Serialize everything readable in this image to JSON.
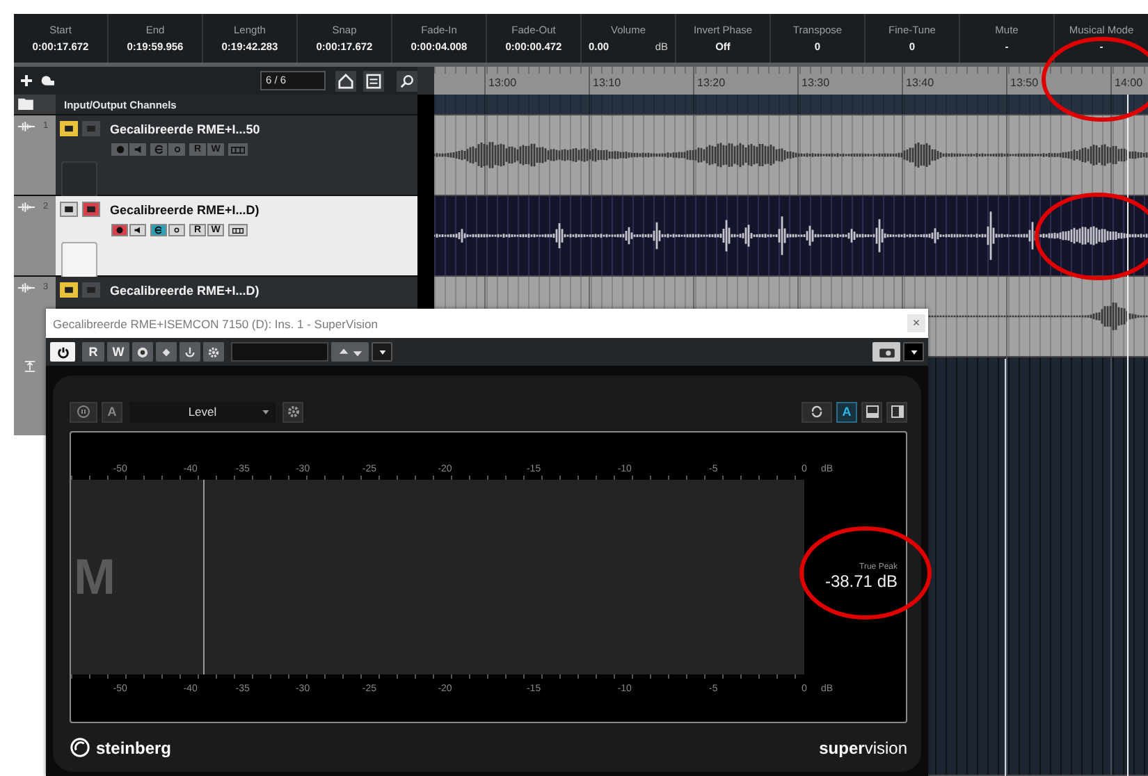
{
  "info_line": [
    {
      "label": "Start",
      "value": "0:00:17.672"
    },
    {
      "label": "End",
      "value": "0:19:59.956"
    },
    {
      "label": "Length",
      "value": "0:19:42.283"
    },
    {
      "label": "Snap",
      "value": "0:00:17.672"
    },
    {
      "label": "Fade-In",
      "value": "0:00:04.008"
    },
    {
      "label": "Fade-Out",
      "value": "0:00:00.472"
    },
    {
      "label": "Volume",
      "value": "0.00",
      "unit": "dB"
    },
    {
      "label": "Invert Phase",
      "value": "Off"
    },
    {
      "label": "Transpose",
      "value": "0"
    },
    {
      "label": "Fine-Tune",
      "value": "0"
    },
    {
      "label": "Mute",
      "value": "-"
    },
    {
      "label": "Musical Mode",
      "value": "-"
    }
  ],
  "track_toolbar": {
    "track_count": "6 / 6"
  },
  "ruler": [
    "13:00",
    "13:10",
    "13:20",
    "13:30",
    "13:40",
    "13:50",
    "14:00"
  ],
  "folder": {
    "name": "Input/Output Channels"
  },
  "tracks": [
    {
      "number": "1",
      "name": "Gecalibreerde RME+I...50",
      "selected": false,
      "mute": true,
      "solo": false,
      "record": false,
      "edit": false,
      "read_label": "R",
      "write_label": "W"
    },
    {
      "number": "2",
      "name": "Gecalibreerde RME+I...D)",
      "selected": true,
      "mute": false,
      "solo": true,
      "record": true,
      "edit": true,
      "read_label": "R",
      "write_label": "W"
    },
    {
      "number": "3",
      "name": "Gecalibreerde RME+I...D)",
      "selected": false,
      "mute": true,
      "solo": false
    }
  ],
  "plugin_window": {
    "title": "Gecalibreerde RME+ISEMCON 7150 (D): Ins. 1 - SuperVision",
    "close": "×",
    "read_label": "R",
    "write_label": "W",
    "meter": {
      "mode": "Level",
      "hold_button": {
        "label": "A",
        "selected": false
      },
      "auto_button": {
        "label": "A",
        "selected": true
      },
      "channel": "M",
      "top_scale": [
        "-50",
        "-40",
        "-35",
        "-30",
        "-25",
        "-20",
        "-15",
        "-10",
        "-5",
        "0"
      ],
      "top_unit": "dB",
      "bottom_scale": [
        "-50",
        "-40",
        "-35",
        "-30",
        "-25",
        "-20",
        "-15",
        "-10",
        "-5",
        "0"
      ],
      "bottom_unit": "dB",
      "peak": {
        "level": 0.18
      },
      "readout_label": "True Peak",
      "readout": "-38.71 dB"
    },
    "brand": "steinberg",
    "product": "**super**vision"
  }
}
